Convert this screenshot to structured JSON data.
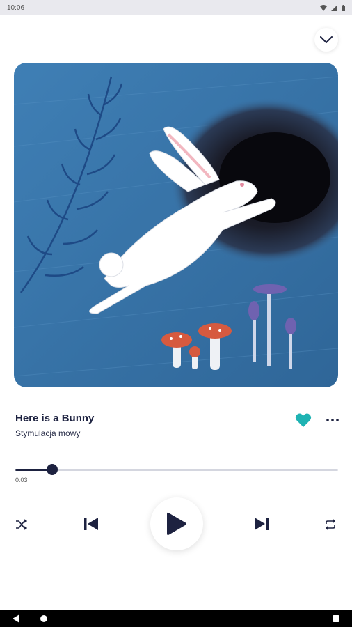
{
  "status_bar": {
    "time": "10:06"
  },
  "header": {
    "collapse_icon": "chevron-down-icon"
  },
  "track": {
    "title": "Here is a Bunny",
    "subtitle": "Stymulacja mowy",
    "liked": true
  },
  "progress": {
    "elapsed": "0:03",
    "fraction": 0.115
  },
  "controls": {
    "shuffle_icon": "shuffle-icon",
    "previous_icon": "skip-previous-icon",
    "play_icon": "play-icon",
    "next_icon": "skip-next-icon",
    "repeat_icon": "repeat-icon"
  },
  "colors": {
    "accent": "#1d2240",
    "like": "#1fb3b3",
    "artwork_bg": "#3a74a8"
  }
}
